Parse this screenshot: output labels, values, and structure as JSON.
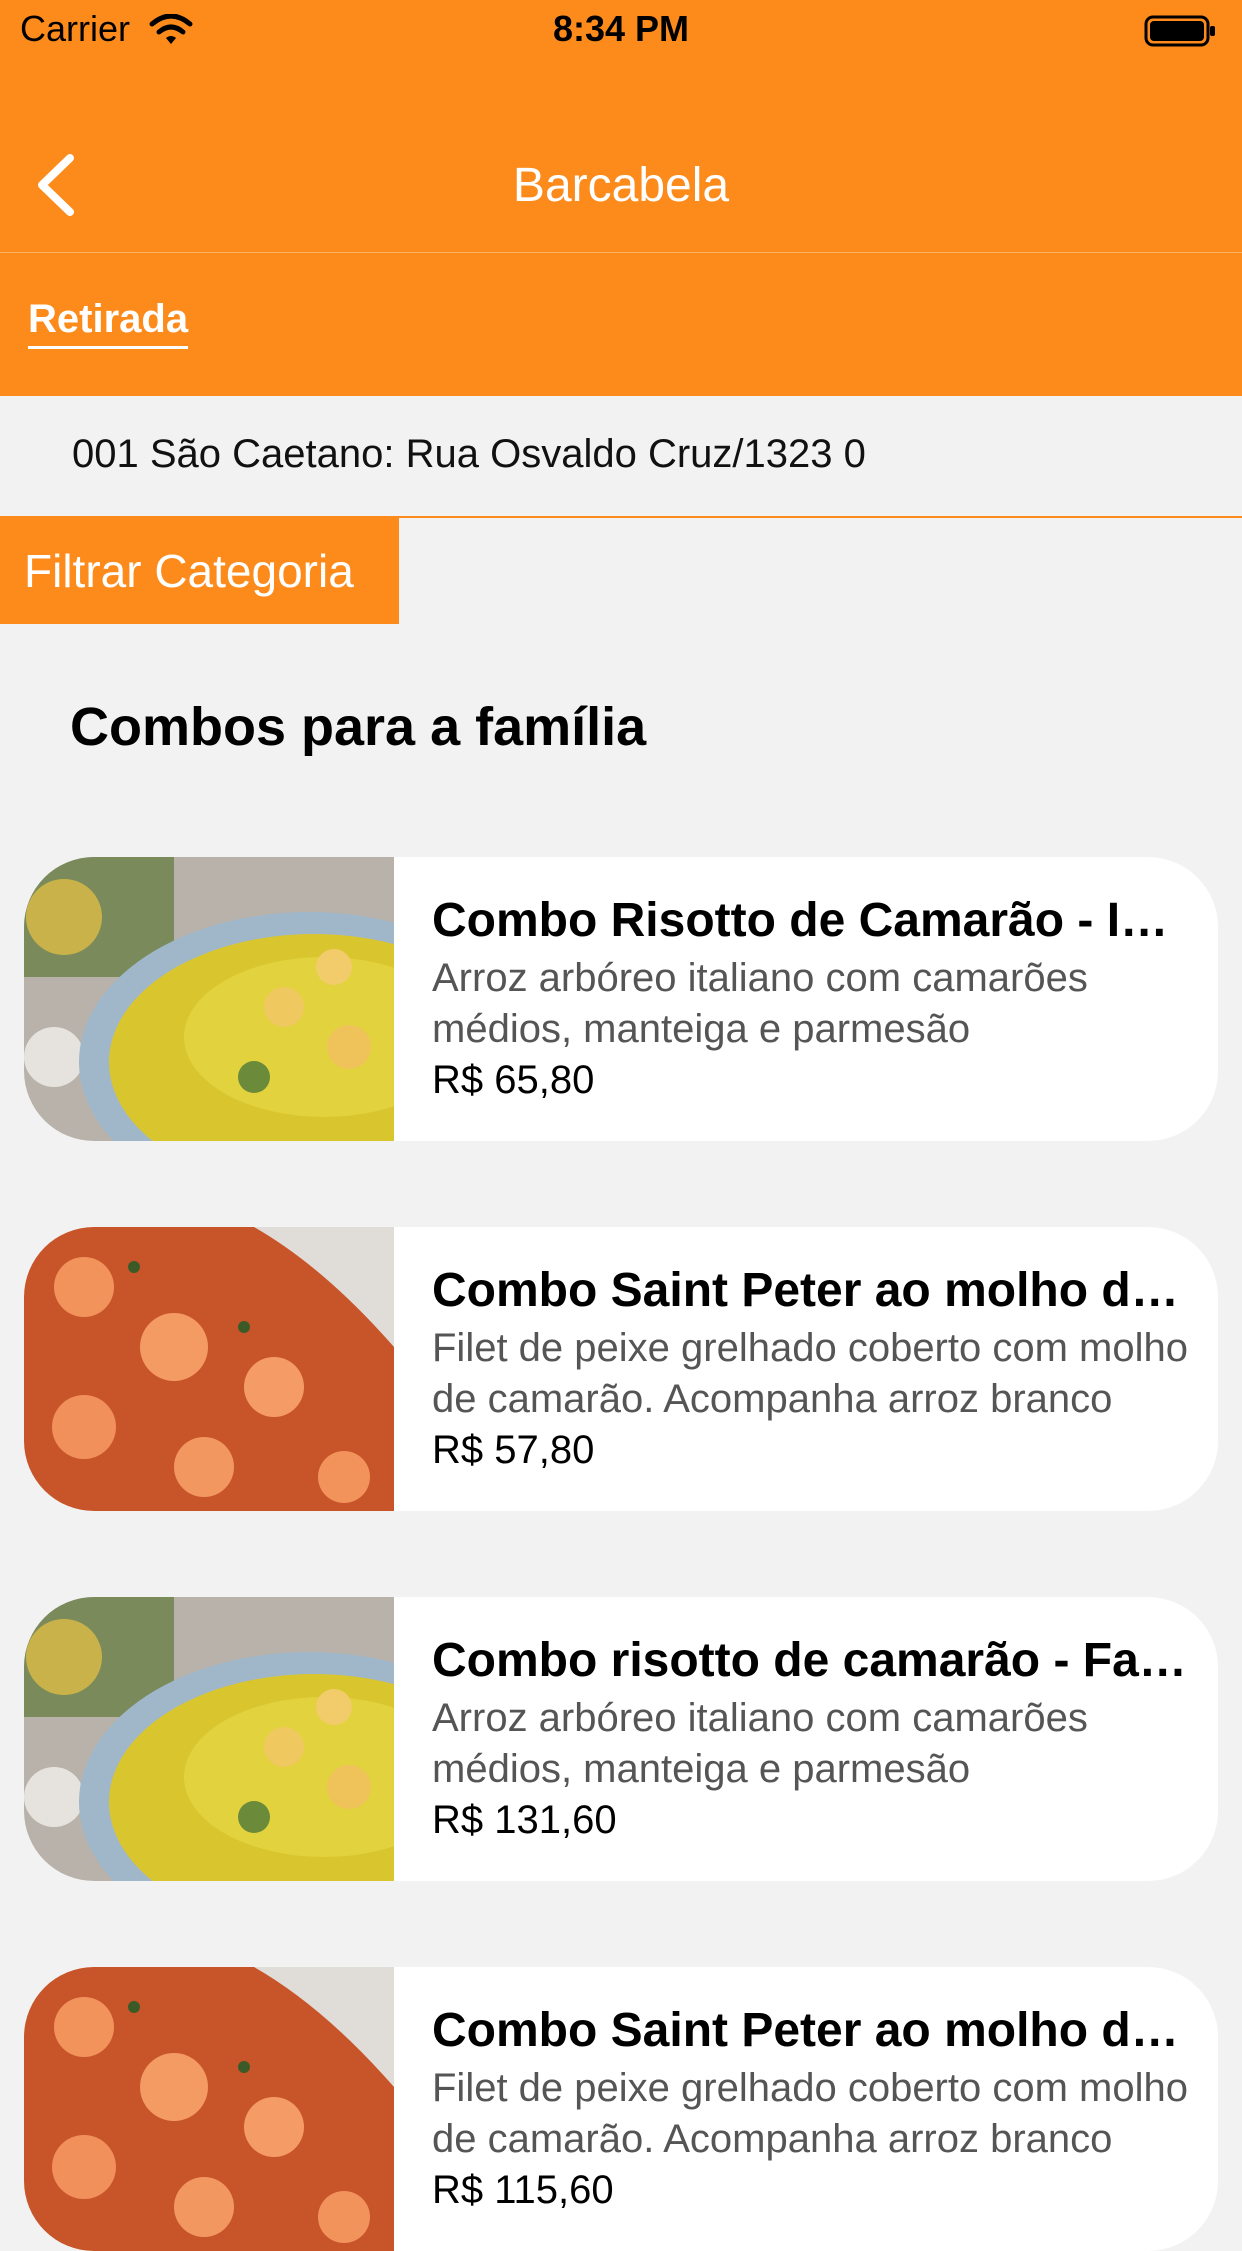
{
  "status_bar": {
    "carrier": "Carrier",
    "time": "8:34 PM"
  },
  "nav": {
    "title": "Barcabela"
  },
  "mode": {
    "label": "Retirada"
  },
  "address": {
    "text": "001 São Caetano: Rua Osvaldo Cruz/1323 0"
  },
  "filter": {
    "label": "Filtrar Categoria"
  },
  "section": {
    "title": "Combos para a família"
  },
  "products": [
    {
      "name": "Combo Risotto de Camarão - Individual",
      "description": "Arroz arbóreo italiano com camarões médios, manteiga e parmesão",
      "price": "R$ 65,80",
      "image": "risotto"
    },
    {
      "name": "Combo Saint Peter ao molho de camarão",
      "description": "Filet de peixe grelhado coberto com molho de camarão. Acompanha arroz branco",
      "price": "R$ 57,80",
      "image": "shrimp-sauce"
    },
    {
      "name": "Combo risotto de camarão - Família",
      "description": "Arroz arbóreo italiano com camarões médios, manteiga e parmesão",
      "price": "R$ 131,60",
      "image": "risotto"
    },
    {
      "name": "Combo Saint Peter ao molho de camarão",
      "description": "Filet de peixe grelhado coberto com molho de camarão. Acompanha arroz branco",
      "price": "R$ 115,60",
      "image": "shrimp-sauce"
    }
  ],
  "colors": {
    "accent": "#fc8b1c",
    "background": "#f2f2f2",
    "card": "#ffffff"
  }
}
